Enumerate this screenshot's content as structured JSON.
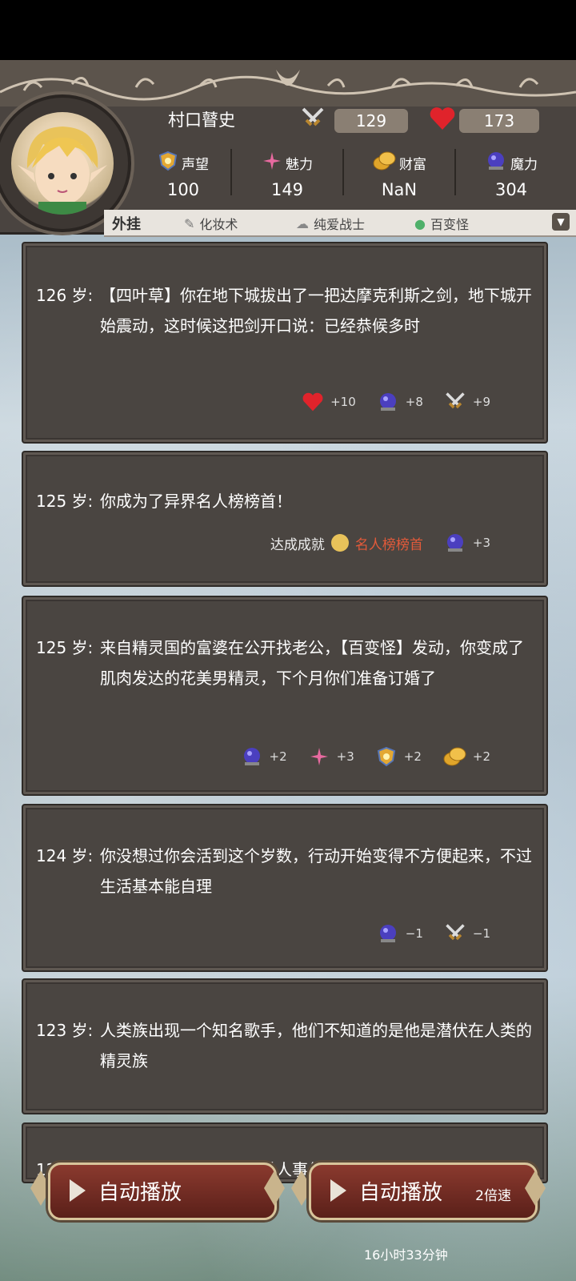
{
  "player": {
    "name": "村口瞽史",
    "attack": "129",
    "health": "173"
  },
  "stats": [
    {
      "label": "声望",
      "value": "100",
      "icon": "shield-star-icon"
    },
    {
      "label": "魅力",
      "value": "149",
      "icon": "sparkle-wand-icon"
    },
    {
      "label": "财富",
      "value": "NaN",
      "icon": "gold-coins-icon"
    },
    {
      "label": "魔力",
      "value": "304",
      "icon": "magic-orb-icon"
    }
  ],
  "extras": {
    "title": "外挂",
    "items": [
      "化妆术",
      "纯爱战士",
      "百变怪"
    ]
  },
  "events": [
    {
      "age": "126 岁:",
      "text": "【四叶草】你在地下城拔出了一把达摩克利斯之剑，地下城开始震动，这时候这把剑开口说：已经恭候多时",
      "rewards": [
        {
          "icon": "heart-icon",
          "value": "+10"
        },
        {
          "icon": "magic-orb-icon",
          "value": "+8"
        },
        {
          "icon": "crossed-swords-icon",
          "value": "+9"
        }
      ]
    },
    {
      "age": "125 岁:",
      "text": "你成为了异界名人榜榜首！",
      "achievement_label": "达成成就",
      "achievement_name": "名人榜榜首",
      "rewards": [
        {
          "icon": "magic-orb-icon",
          "value": "+3"
        }
      ]
    },
    {
      "age": "125 岁:",
      "text": "来自精灵国的富婆在公开找老公，【百变怪】发动，你变成了肌肉发达的花美男精灵，下个月你们准备订婚了",
      "rewards": [
        {
          "icon": "magic-orb-icon",
          "value": "+2"
        },
        {
          "icon": "sparkle-wand-icon",
          "value": "+3"
        },
        {
          "icon": "shield-star-icon",
          "value": "+2"
        },
        {
          "icon": "gold-coins-icon",
          "value": "+2"
        }
      ]
    },
    {
      "age": "124 岁:",
      "text": "你没想过你会活到这个岁数，行动开始变得不方便起来，不过生活基本能自理",
      "rewards": [
        {
          "icon": "magic-orb-icon",
          "value": "−1"
        },
        {
          "icon": "crossed-swords-icon",
          "value": "−1"
        }
      ]
    },
    {
      "age": "123 岁:",
      "text": "人类族出现一个知名歌手，他们不知道的是他是潜伏在人类的精灵族",
      "rewards": []
    },
    {
      "age": "122 岁:",
      "text": "精灵王国首都发生连环杀人事件，一个带眼镜红领带",
      "rewards": []
    }
  ],
  "buttons": {
    "autoplay": "自动播放",
    "autoplay2": "自动播放",
    "speed": "2倍速"
  },
  "timer": "16小时33分钟",
  "colors": {
    "panel": "#4a4541",
    "accent_red": "#e25a3a",
    "button": "#7a2f25"
  }
}
